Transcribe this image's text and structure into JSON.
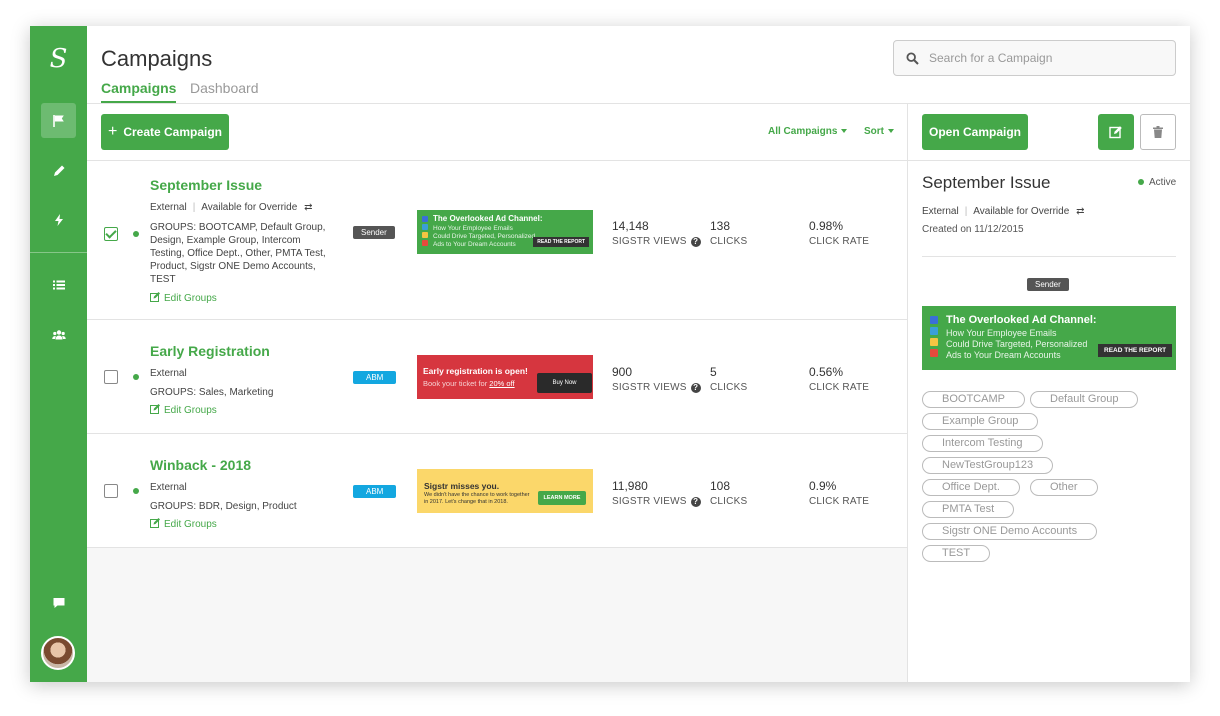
{
  "app": {
    "logo": "S",
    "nav": [
      "flag-icon",
      "pencil-icon",
      "bolt-icon",
      "list-icon",
      "users-icon",
      "chat-icon"
    ]
  },
  "header": {
    "title": "Campaigns",
    "tabs": [
      {
        "label": "Campaigns",
        "active": true
      },
      {
        "label": "Dashboard",
        "active": false
      }
    ],
    "search_placeholder": "Search for a Campaign"
  },
  "toolbar": {
    "create_label": "Create Campaign",
    "filter_label": "All Campaigns",
    "sort_label": "Sort"
  },
  "stat_labels": {
    "views": "SIGSTR VIEWS",
    "clicks": "CLICKS",
    "rate": "CLICK RATE"
  },
  "campaigns": [
    {
      "name": "September Issue",
      "checked": true,
      "type": "External",
      "override": "Available for Override",
      "groups": "GROUPS: BOOTCAMP, Default Group, Design, Example Group, Intercom Testing, Office Dept., Other, PMTA Test, Product, Sigstr ONE Demo Accounts, TEST",
      "edit_label": "Edit Groups",
      "badge": "Sender",
      "views": "14,148",
      "clicks": "138",
      "rate": "0.98%",
      "banner": {
        "title": "The Overlooked Ad Channel:",
        "lines": [
          "How Your Employee Emails",
          "Could Drive Targeted, Personalized",
          "Ads to Your Dream Accounts"
        ],
        "cta": "READ THE REPORT"
      }
    },
    {
      "name": "Early Registration",
      "checked": false,
      "type": "External",
      "groups": "GROUPS: Sales, Marketing",
      "edit_label": "Edit Groups",
      "badge": "ABM",
      "views": "900",
      "clicks": "5",
      "rate": "0.56%",
      "banner": {
        "title": "Early registration is open!",
        "sub": "Book your ticket for",
        "sub_link": "20% off",
        "cta": "Buy Now"
      }
    },
    {
      "name": "Winback - 2018",
      "checked": false,
      "type": "External",
      "groups": "GROUPS: BDR, Design, Product",
      "edit_label": "Edit Groups",
      "badge": "ABM",
      "views": "11,980",
      "clicks": "108",
      "rate": "0.9%",
      "banner": {
        "title": "Sigstr misses you.",
        "sub": "We didn't have the chance to work together in 2017. Let's change that in 2018.",
        "cta": "LEARN MORE"
      }
    }
  ],
  "detail": {
    "open_label": "Open Campaign",
    "title": "September Issue",
    "status": "Active",
    "type": "External",
    "override": "Available for Override",
    "created": "Created on 11/12/2015",
    "badge": "Sender",
    "banner": {
      "title": "The Overlooked Ad Channel:",
      "lines": [
        "How Your Employee Emails",
        "Could Drive Targeted, Personalized",
        "Ads to Your Dream Accounts"
      ],
      "cta": "READ THE REPORT"
    },
    "groups": [
      "BOOTCAMP",
      "Default Group",
      "Example Group",
      "Intercom Testing",
      "NewTestGroup123",
      "Office Dept.",
      "Other",
      "PMTA Test",
      "Sigstr ONE Demo Accounts",
      "TEST"
    ]
  },
  "colors": {
    "brand": "#45a849",
    "abm": "#13a7e0",
    "sender": "#555555"
  }
}
